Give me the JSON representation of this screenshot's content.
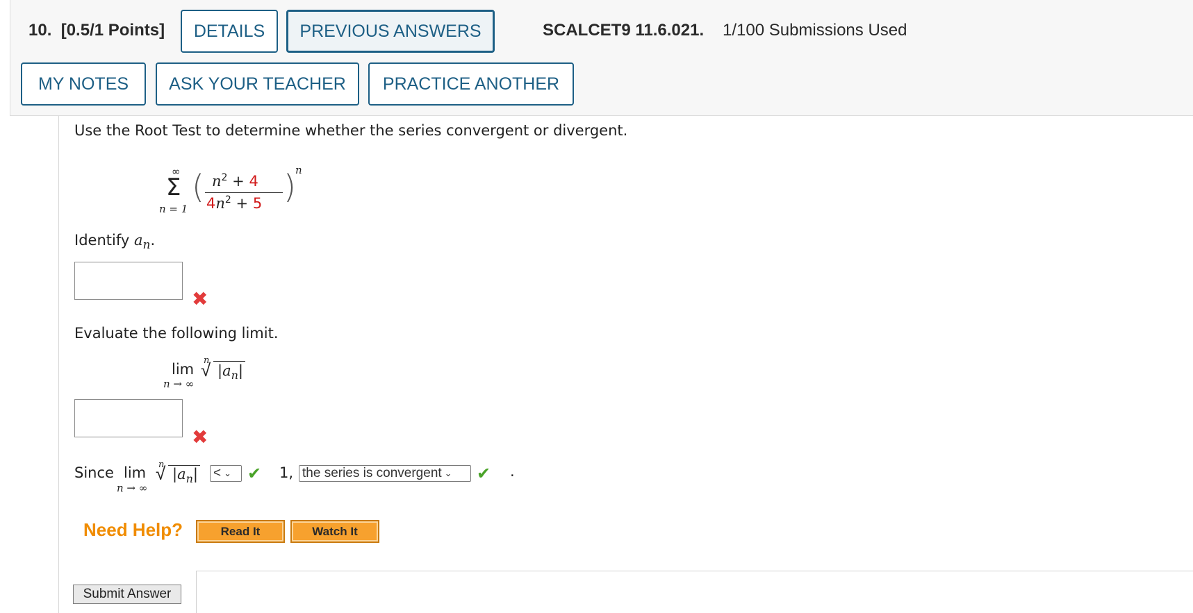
{
  "header": {
    "question_number": "10.",
    "points": "[0.5/1 Points]",
    "details_label": "DETAILS",
    "previous_answers_label": "PREVIOUS ANSWERS",
    "problem_code": "SCALCET9 11.6.021.",
    "submissions": "1/100 Submissions Used",
    "my_notes_label": "MY NOTES",
    "ask_teacher_label": "ASK YOUR TEACHER",
    "practice_another_label": "PRACTICE ANOTHER"
  },
  "question": {
    "instruction": "Use the Root Test to determine whether the series convergent or divergent.",
    "series": {
      "sum_upper": "∞",
      "sum_lower": "n = 1",
      "num_var": "n",
      "num_exp": "2",
      "num_plus": "+",
      "num_const": "4",
      "den_coef": "4",
      "den_var": "n",
      "den_exp": "2",
      "den_plus": "+",
      "den_const": "5",
      "power": "n"
    },
    "identify_label": "Identify",
    "identify_var": "a",
    "identify_sub": "n",
    "identify_period": ".",
    "evaluate_label": "Evaluate the following limit.",
    "lim_word": "lim",
    "lim_under": "n → ∞",
    "root_index": "n",
    "abs_var": "|a",
    "abs_sub": "n",
    "abs_close": "|",
    "since_label": "Since",
    "comparison_selected": "<",
    "one_label": "1,",
    "conclusion_selected": "the series is convergent",
    "final_period": "."
  },
  "help": {
    "need_help_label": "Need Help?",
    "read_it_label": "Read It",
    "watch_it_label": "Watch It"
  },
  "submit_label": "Submit Answer",
  "marks": {
    "incorrect": "✖",
    "correct": "✔"
  }
}
